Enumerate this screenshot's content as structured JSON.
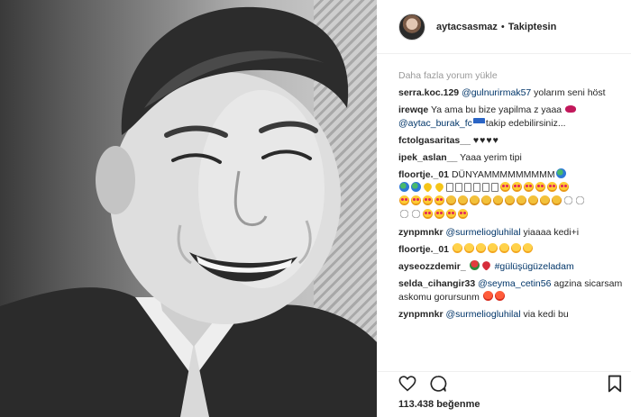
{
  "header": {
    "username": "aytacsasmaz",
    "separator": "•",
    "follow_status": "Takiptesin"
  },
  "load_more": "Daha fazla yorum yükle",
  "comments": [
    {
      "user": "serra.koc.129",
      "mention": "@gulnurirmak57",
      "text": " yolarım seni höst"
    },
    {
      "user": "irewqe",
      "text_before": "Ya ama bu bize yapilma z yaaa",
      "mention": "@aytac_burak_fc",
      "text_after": "takip edebilirsiniz..."
    },
    {
      "user": "fctolgasaritas__",
      "text": "♥♥♥♥"
    },
    {
      "user": "ipek_aslan__",
      "text": "Yaaa yerim tipi"
    },
    {
      "user": "floortje._01",
      "text": "DÜNYAMMMMMMMMM"
    },
    {
      "user": "zynpmnkr",
      "mention": "@surmeliogluhilal",
      "text": " yiaaaa kedi+i"
    },
    {
      "user": "floortje._01",
      "text": ""
    },
    {
      "user": "ayseozzdemir_",
      "text": "",
      "hashtag": "#gülüşügüzeladam"
    },
    {
      "user": "selda_cihangir33",
      "mention": "@seyma_cetin56",
      "text": " agzina sicarsam askomu gorursunm"
    },
    {
      "user": "zynpmnkr",
      "mention": "@surmeliogluhilal",
      "text": " via kedi bu"
    }
  ],
  "actions": {
    "like_icon": "heart-outline-icon",
    "comment_icon": "comment-bubble-icon",
    "save_icon": "bookmark-icon"
  },
  "likes_text": "113.438 beğenme",
  "colors": {
    "mention": "#003569",
    "muted": "#999999",
    "text": "#262626",
    "border": "#efefef"
  }
}
